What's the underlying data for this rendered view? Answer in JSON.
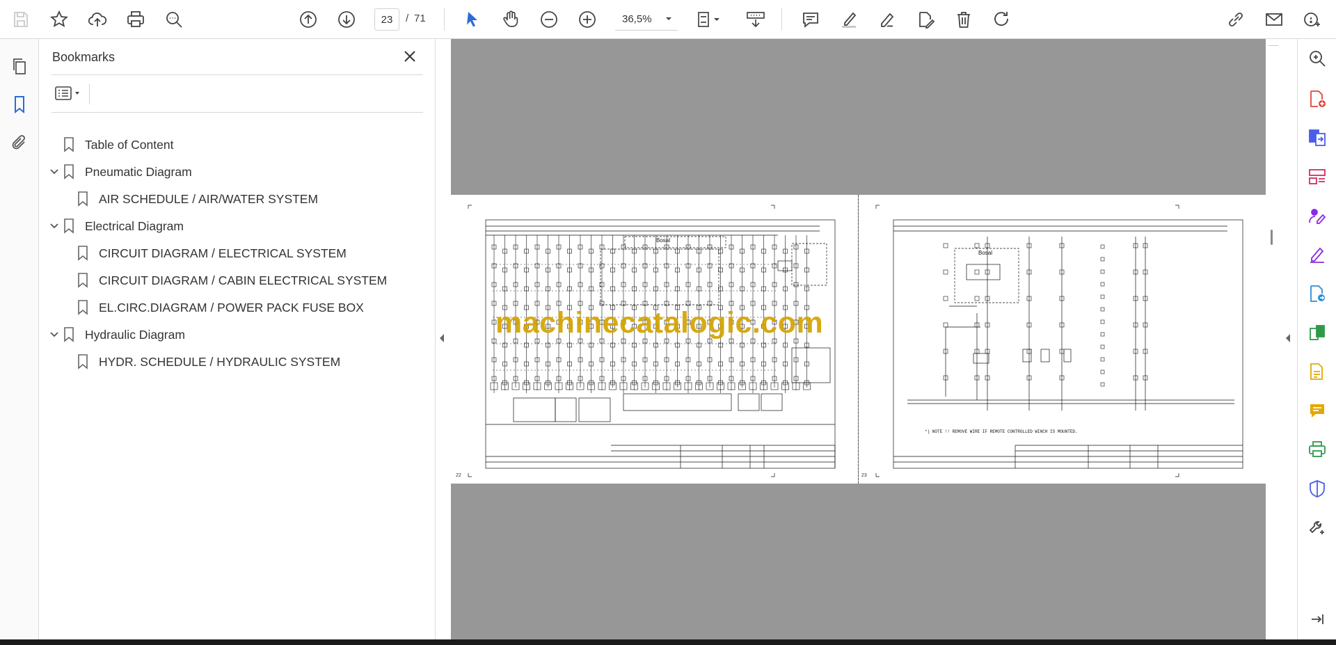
{
  "toolbar": {
    "current_page": "23",
    "page_separator": "/",
    "total_pages": "71",
    "zoom": "36,5%"
  },
  "bookmarks": {
    "title": "Bookmarks",
    "items": [
      {
        "label": "Table of Content",
        "level": 0,
        "expandable": false
      },
      {
        "label": "Pneumatic Diagram",
        "level": 0,
        "expandable": true
      },
      {
        "label": "AIR SCHEDULE / AIR/WATER SYSTEM",
        "level": 1,
        "expandable": false
      },
      {
        "label": "Electrical Diagram",
        "level": 0,
        "expandable": true
      },
      {
        "label": "CIRCUIT DIAGRAM / ELECTRICAL SYSTEM",
        "level": 1,
        "expandable": false
      },
      {
        "label": "CIRCUIT DIAGRAM / CABIN ELECTRICAL SYSTEM",
        "level": 1,
        "expandable": false
      },
      {
        "label": "EL.CIRC.DIAGRAM / POWER PACK FUSE BOX",
        "level": 1,
        "expandable": false
      },
      {
        "label": "Hydraulic Diagram",
        "level": 0,
        "expandable": true
      },
      {
        "label": "HYDR. SCHEDULE / HYDRAULIC SYSTEM",
        "level": 1,
        "expandable": false
      }
    ]
  },
  "document": {
    "watermark": "machinecatalogic.com",
    "left_page_number": "22",
    "right_page_number": "23",
    "left_box_label": "Bosal",
    "right_box_label": "Bosal",
    "right_note": "*) NOTE !! REMOVE WIRE IF REMOTE CONTROLLED WINCH IS MOUNTED."
  },
  "colors": {
    "accent_blue": "#2c6bd6",
    "tool_purple": "#8a2be2",
    "tool_red": "#e0463c",
    "tool_green": "#2e9a4a",
    "tool_yellow": "#e6a800",
    "canvas_gray": "#979797",
    "watermark": "#d4a300"
  }
}
